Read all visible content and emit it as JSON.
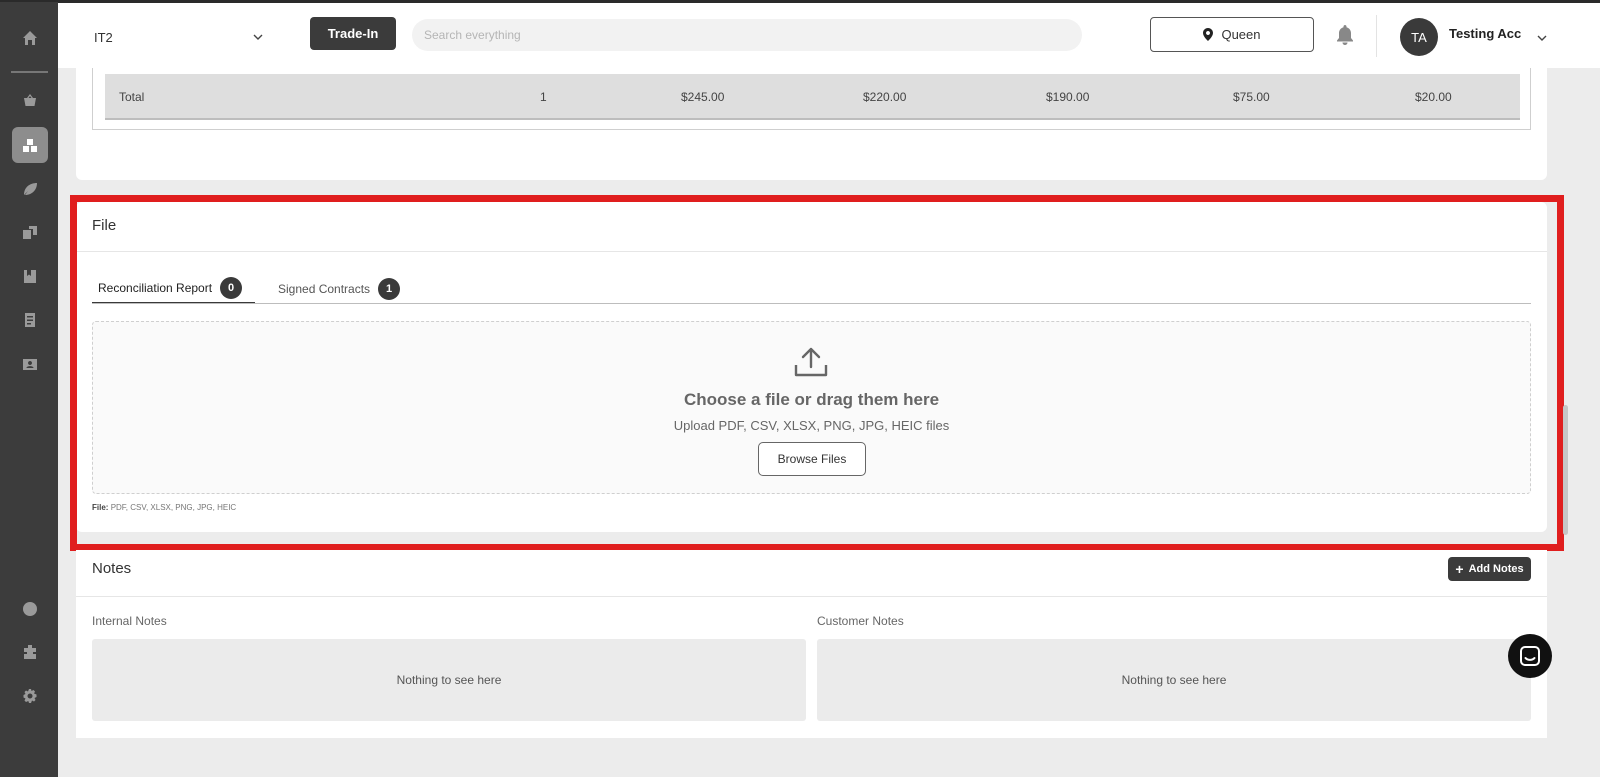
{
  "header": {
    "store": "IT2",
    "trade_in_label": "Trade-In",
    "search_placeholder": "Search everything",
    "location": "Queen",
    "user_initials": "TA",
    "user_name": "Testing Acc"
  },
  "sidebar": {
    "items": [
      "home-icon",
      "basket-icon",
      "inventory-icon",
      "leaf-icon",
      "boxes-icon",
      "bookmark-icon",
      "receipt-icon",
      "contacts-icon",
      "help-icon",
      "plugin-icon",
      "settings-icon"
    ],
    "active": "inventory-icon"
  },
  "totals": {
    "label": "Total",
    "qty": "1",
    "col1": "$245.00",
    "col2": "$220.00",
    "col3": "$190.00",
    "col4": "$75.00",
    "col5": "$20.00"
  },
  "file_section": {
    "title": "File",
    "tabs": [
      {
        "label": "Reconciliation Report",
        "count": "0"
      },
      {
        "label": "Signed Contracts",
        "count": "1"
      }
    ],
    "dropzone_title": "Choose a file or drag them here",
    "dropzone_subtitle": "Upload PDF, CSV, XLSX, PNG, JPG, HEIC files",
    "browse_label": "Browse Files",
    "note_label": "File:",
    "note_types": "PDF, CSV, XLSX, PNG, JPG, HEIC"
  },
  "notes_section": {
    "title": "Notes",
    "add_label": "Add Notes",
    "internal_label": "Internal Notes",
    "customer_label": "Customer Notes",
    "empty_text": "Nothing to see here"
  },
  "colors": {
    "highlight": "#e01e1e",
    "sidebar": "#3c3c3c",
    "dark_button": "#3b3b3b"
  }
}
